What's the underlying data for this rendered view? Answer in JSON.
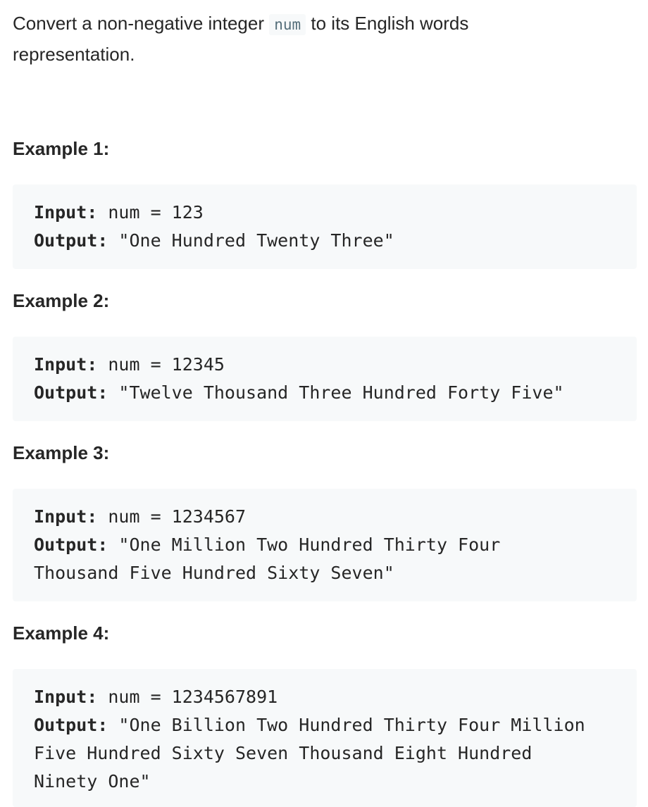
{
  "description": {
    "before_code": "Convert a non-negative integer ",
    "code": "num",
    "after_code": " to its English words representation."
  },
  "examples": [
    {
      "title": "Example 1:",
      "input_label": "Input:",
      "input_value": " num = 123",
      "output_label": "Output:",
      "output_value": " \"One Hundred Twenty Three\""
    },
    {
      "title": "Example 2:",
      "input_label": "Input:",
      "input_value": " num = 12345",
      "output_label": "Output:",
      "output_value": " \"Twelve Thousand Three Hundred Forty Five\""
    },
    {
      "title": "Example 3:",
      "input_label": "Input:",
      "input_value": " num = 1234567",
      "output_label": "Output:",
      "output_value": " \"One Million Two Hundred Thirty Four\nThousand Five Hundred Sixty Seven\""
    },
    {
      "title": "Example 4:",
      "input_label": "Input:",
      "input_value": " num = 1234567891",
      "output_label": "Output:",
      "output_value": " \"One Billion Two Hundred Thirty Four Million\nFive Hundred Sixty Seven Thousand Eight Hundred\nNinety One\""
    }
  ]
}
